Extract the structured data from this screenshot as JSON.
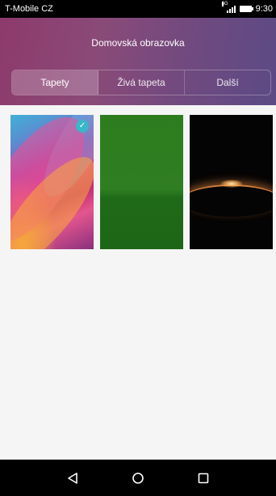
{
  "status_bar": {
    "carrier": "T-Mobile CZ",
    "network_label": "4G",
    "time": "9:30"
  },
  "header": {
    "title": "Domovská obrazovka",
    "tabs": [
      {
        "label": "Tapety",
        "active": true
      },
      {
        "label": "Živá tapeta",
        "active": false
      },
      {
        "label": "Další",
        "active": false
      }
    ]
  },
  "wallpapers": [
    {
      "name": "colorful-petals-wallpaper",
      "selected": true
    },
    {
      "name": "green-hills-wallpaper",
      "selected": false
    },
    {
      "name": "planet-horizon-wallpaper",
      "selected": false
    }
  ],
  "colors": {
    "accent_check": "#3ab7c8",
    "header_gradient_start": "#8d3a6c",
    "header_gradient_end": "#5c4a84"
  },
  "icons": {
    "selected": "check-icon",
    "back": "back-triangle-icon",
    "home": "home-circle-icon",
    "recents": "recents-square-icon",
    "signal": "signal-icon",
    "battery": "battery-icon"
  }
}
